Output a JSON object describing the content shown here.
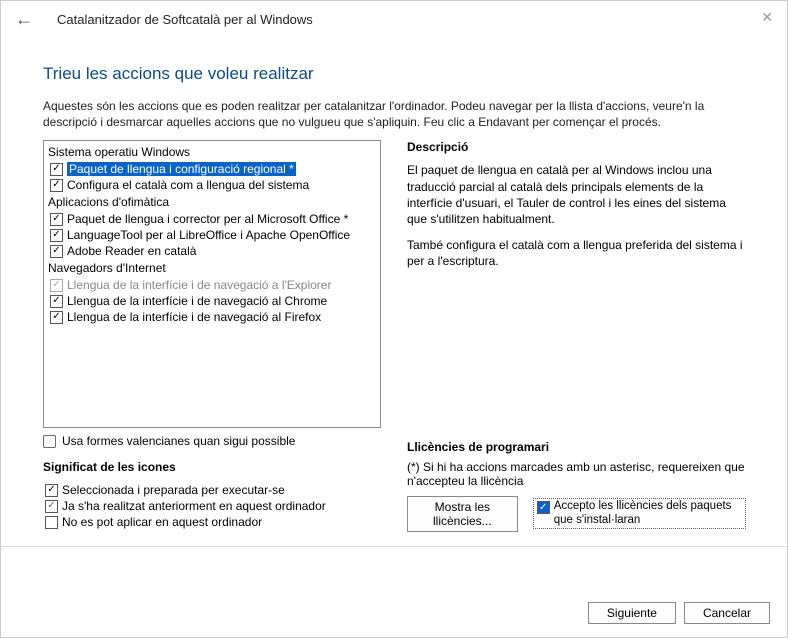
{
  "window": {
    "title": "Catalanitzador de Softcatalà per al Windows"
  },
  "heading": "Trieu les accions que voleu realitzar",
  "intro": "Aquestes són les accions que es poden realitzar per catalanitzar l'ordinador. Podeu navegar per la llista d'accions, veure'n la descripció i desmarcar aquelles accions que no vulgueu que s'apliquin. Feu clic a Endavant per començar el procés.",
  "actions": {
    "group1": {
      "label": "Sistema operatiu Windows",
      "items": [
        {
          "label": "Paquet de llengua i configuració regional *",
          "selected": true
        },
        {
          "label": "Configura el català com a llengua del sistema"
        }
      ]
    },
    "group2": {
      "label": "Aplicacions d'ofimàtica",
      "items": [
        {
          "label": "Paquet de llengua i corrector per al Microsoft Office *"
        },
        {
          "label": "LanguageTool per al LibreOffice i Apache OpenOffice"
        },
        {
          "label": "Adobe Reader en català"
        }
      ]
    },
    "group3": {
      "label": "Navegadors d'Internet",
      "items": [
        {
          "label": "Llengua de la interfície i de navegació a l'Explorer",
          "disabled": true
        },
        {
          "label": "Llengua de la interfície i de navegació al Chrome"
        },
        {
          "label": "Llengua de la interfície i de navegació al Firefox"
        }
      ]
    }
  },
  "valencia": "Usa formes valencianes quan sigui possible",
  "legend": {
    "title": "Significat de les icones",
    "items": [
      "Seleccionada i preparada per executar-se",
      "Ja s'ha realitzat anteriorment en aquest ordinador",
      "No es pot aplicar en aquest ordinador"
    ]
  },
  "description": {
    "title": "Descripció",
    "p1": "El paquet de llengua en català per al Windows inclou una traducció parcial al català dels principals elements de la interfície d'usuari, el Tauler de control i les eines del sistema que s'utilitzen habitualment.",
    "p2": "També configura el català com a llengua preferida del sistema i per a l'escriptura."
  },
  "licenses": {
    "title": "Llicències de programari",
    "note": "(*) Si hi ha accions marcades amb un asterisc, requereixen que n'accepteu la llicència",
    "show_button": "Mostra les llicències...",
    "accept": "Accepto les llicències dels paquets que s'instal·laran"
  },
  "footer": {
    "next": "Siguiente",
    "cancel": "Cancelar"
  }
}
